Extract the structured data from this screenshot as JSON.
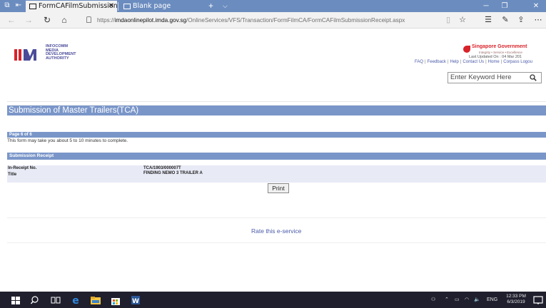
{
  "browser": {
    "tabs": [
      {
        "label": "FormCAFilmSubmission",
        "active": true
      },
      {
        "label": "Blank page",
        "active": false
      }
    ],
    "new_tab_glyph": "+",
    "address": {
      "scheme": "https://",
      "host": "imdaonlinepilot.imda.gov.sg",
      "path": "/OnlineServices/VFS/Transaction/FormFilmCA/FormCAFilmSubmissionReceipt.aspx"
    }
  },
  "header": {
    "logo_text": [
      "INFOCOMM",
      "MEDIA",
      "DEVELOPMENT",
      "AUTHORITY"
    ],
    "sg_gov": {
      "name": "Singapore Government",
      "tagline": "Integrity • Service • Excellence",
      "last_updated": "Last Updated On : 04 Mar 201"
    },
    "links": [
      "FAQ",
      "Feedback",
      "Help",
      "Contact Us",
      "Home",
      "Corpass Logou"
    ],
    "search_placeholder": "Enter Keyword Here"
  },
  "form": {
    "title": "Submission of Master Trailers(TCA)",
    "page_label": "Page 6 of 6",
    "page_note": "This form may take you about 5 to 10 minutes to complete.",
    "section_title": "Submission Receipt",
    "fields": [
      {
        "label": "In-Receipt No.",
        "value": "TCA/1903/000007T"
      },
      {
        "label": "Title",
        "value": "FINDING NEMO 3 TRAILER A"
      }
    ],
    "print_label": "Print",
    "rate_label": "Rate this e-service"
  },
  "taskbar": {
    "lang": "ENG",
    "time": "12:33 PM",
    "date": "6/3/2019"
  },
  "colors": {
    "band": "#7a96c9",
    "link": "#4a5aa8",
    "tabbar": "#6b8cbf",
    "taskbar": "#1f1f2e"
  }
}
